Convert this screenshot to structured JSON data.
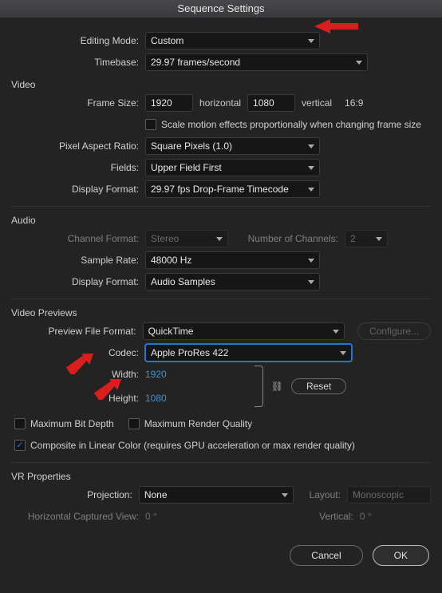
{
  "title": "Sequence Settings",
  "editingMode": {
    "label": "Editing Mode:",
    "value": "Custom"
  },
  "timebase": {
    "label": "Timebase:",
    "value": "29.97  frames/second"
  },
  "video": {
    "section": "Video",
    "frameSize": {
      "label": "Frame Size:",
      "w": "1920",
      "horizontal": "horizontal",
      "h": "1080",
      "vertical": "vertical",
      "ratio": "16:9"
    },
    "scaleMotion": {
      "label": "Scale motion effects proportionally when changing frame size"
    },
    "par": {
      "label": "Pixel Aspect Ratio:",
      "value": "Square Pixels (1.0)"
    },
    "fields": {
      "label": "Fields:",
      "value": "Upper Field First"
    },
    "displayFormat": {
      "label": "Display Format:",
      "value": "29.97 fps Drop-Frame Timecode"
    }
  },
  "audio": {
    "section": "Audio",
    "channelFormat": {
      "label": "Channel Format:",
      "value": "Stereo"
    },
    "numChannels": {
      "label": "Number of Channels:",
      "value": "2"
    },
    "sampleRate": {
      "label": "Sample Rate:",
      "value": "48000 Hz"
    },
    "displayFormat": {
      "label": "Display Format:",
      "value": "Audio Samples"
    }
  },
  "previews": {
    "section": "Video Previews",
    "fileFormat": {
      "label": "Preview File Format:",
      "value": "QuickTime"
    },
    "configure": "Configure...",
    "codec": {
      "label": "Codec:",
      "value": "Apple ProRes 422"
    },
    "width": {
      "label": "Width:",
      "value": "1920"
    },
    "height": {
      "label": "Height:",
      "value": "1080"
    },
    "reset": "Reset",
    "maxBitDepth": "Maximum Bit Depth",
    "maxRenderQ": "Maximum Render Quality",
    "compositeLinear": "Composite in Linear Color (requires GPU acceleration or max render quality)"
  },
  "vr": {
    "section": "VR Properties",
    "projection": {
      "label": "Projection:",
      "value": "None"
    },
    "layout": {
      "label": "Layout:",
      "value": "Monoscopic"
    },
    "horiz": {
      "label": "Horizontal Captured View:",
      "value": "0 °"
    },
    "vert": {
      "label": "Vertical:",
      "value": "0 °"
    }
  },
  "buttons": {
    "cancel": "Cancel",
    "ok": "OK"
  }
}
